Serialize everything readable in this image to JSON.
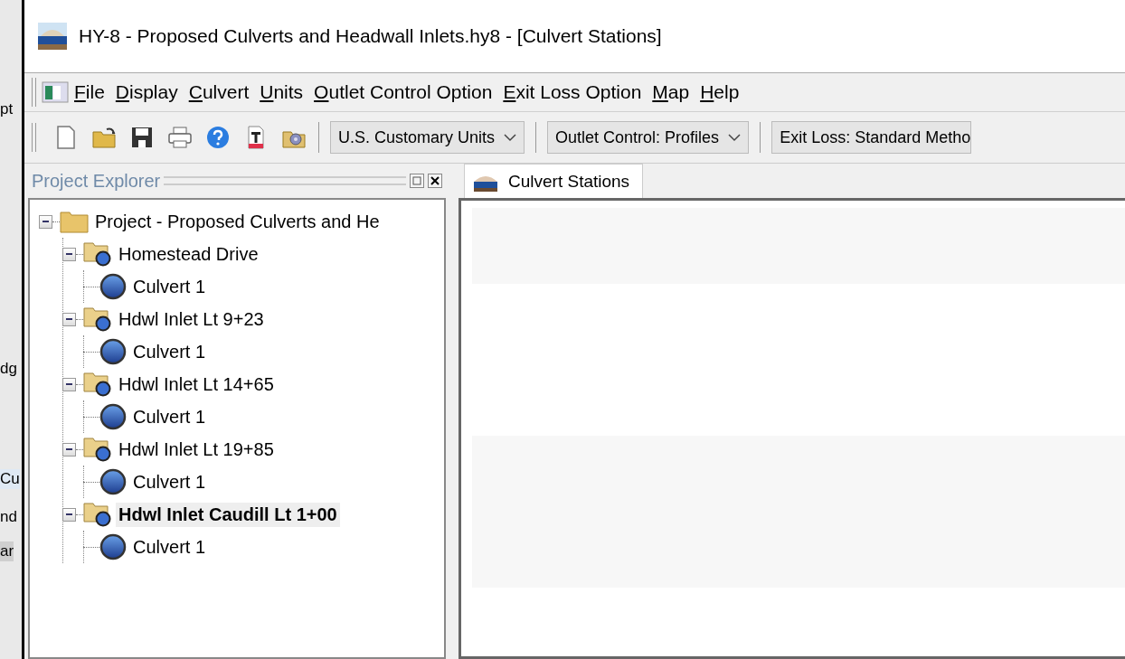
{
  "background_window": {
    "fragments": [
      "pt",
      "dg",
      "Cu",
      "nd",
      "ar"
    ]
  },
  "window": {
    "title": "HY-8 - Proposed Culverts and Headwall Inlets.hy8 - [Culvert Stations]"
  },
  "menu": [
    {
      "key": "F",
      "rest": "ile"
    },
    {
      "key": "D",
      "rest": "isplay"
    },
    {
      "key": "C",
      "rest": "ulvert"
    },
    {
      "key": "U",
      "rest": "nits"
    },
    {
      "key": "O",
      "rest": "utlet Control Option"
    },
    {
      "key": "E",
      "rest": "xit Loss Option"
    },
    {
      "key": "M",
      "rest": "ap"
    },
    {
      "key": "H",
      "rest": "elp"
    }
  ],
  "toolbar": {
    "buttons": [
      {
        "kind": "new"
      },
      {
        "kind": "open"
      },
      {
        "kind": "save"
      },
      {
        "kind": "print"
      },
      {
        "kind": "help"
      },
      {
        "kind": "pdf"
      },
      {
        "kind": "settings"
      }
    ],
    "dropdowns": [
      {
        "value": "U.S. Customary Units"
      },
      {
        "value": "Outlet Control: Profiles"
      },
      {
        "value": "Exit Loss: Standard Metho"
      }
    ]
  },
  "explorer": {
    "title": "Project Explorer",
    "tree": [
      {
        "label": "Project - Proposed Culverts and He",
        "kind": "project",
        "expanded": true,
        "selected": false,
        "children": [
          {
            "label": "Homestead Drive",
            "kind": "crossing",
            "expanded": true,
            "selected": false,
            "children": [
              {
                "label": "Culvert 1",
                "kind": "culvert",
                "selected": false
              }
            ]
          },
          {
            "label": "Hdwl Inlet Lt 9+23",
            "kind": "crossing",
            "expanded": true,
            "selected": false,
            "children": [
              {
                "label": "Culvert 1",
                "kind": "culvert",
                "selected": false
              }
            ]
          },
          {
            "label": "Hdwl Inlet Lt 14+65",
            "kind": "crossing",
            "expanded": true,
            "selected": false,
            "children": [
              {
                "label": "Culvert 1",
                "kind": "culvert",
                "selected": false
              }
            ]
          },
          {
            "label": "Hdwl Inlet Lt 19+85",
            "kind": "crossing",
            "expanded": true,
            "selected": false,
            "children": [
              {
                "label": "Culvert 1",
                "kind": "culvert",
                "selected": false
              }
            ]
          },
          {
            "label": "Hdwl Inlet Caudill Lt 1+00",
            "kind": "crossing",
            "expanded": true,
            "selected": true,
            "children": [
              {
                "label": "Culvert 1",
                "kind": "culvert",
                "selected": false
              }
            ]
          }
        ]
      }
    ]
  },
  "document_tabs": [
    {
      "label": "Culvert Stations",
      "selected": true
    }
  ]
}
